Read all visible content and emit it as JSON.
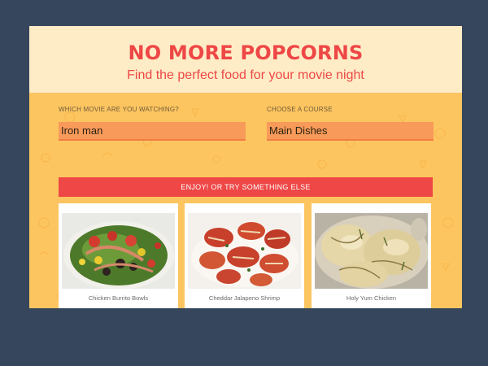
{
  "header": {
    "title": "NO MORE POPCORNS",
    "subtitle": "Find the perfect food for your movie night"
  },
  "form": {
    "movie_label": "WHICH MOVIE ARE YOU WATCHING?",
    "movie_value": "Iron man",
    "course_label": "CHOOSE A COURSE",
    "course_value": "Main Dishes",
    "cta_label": "ENJOY! OR TRY SOMETHING ELSE"
  },
  "results": [
    {
      "name": "Chicken Burrito Bowls"
    },
    {
      "name": "Cheddar Jalapeno Shrimp"
    },
    {
      "name": "Holy Yum Chicken"
    }
  ],
  "colors": {
    "page_bg": "#36465d",
    "header_bg": "#feecc6",
    "panel_bg": "#fdc560",
    "accent": "#ee4746",
    "select_bg": "#f79a5a"
  }
}
